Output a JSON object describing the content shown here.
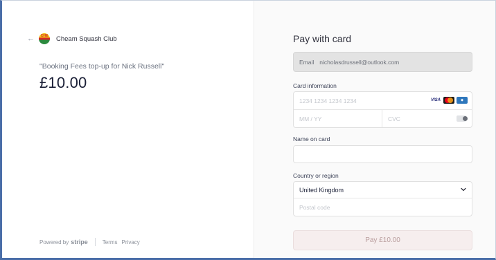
{
  "merchant": {
    "name": "Cheam Squash Club",
    "back_icon": "arrow-left-icon",
    "logo_icon": "club-logo-icon",
    "logo_text": "CHEAM"
  },
  "product": {
    "description": "\"Booking Fees top-up for Nick Russell\"",
    "price": "£10.00"
  },
  "footer": {
    "powered_by": "Powered by",
    "brand": "stripe",
    "terms": "Terms",
    "privacy": "Privacy"
  },
  "form": {
    "title": "Pay with card",
    "email_label": "Email",
    "email_value": "nicholasdrussell@outlook.com",
    "card_info_label": "Card information",
    "card_number_placeholder": "1234 1234 1234 1234",
    "expiry_placeholder": "MM / YY",
    "cvc_placeholder": "CVC",
    "card_brands": [
      "VISA",
      "mastercard",
      "amex"
    ],
    "name_label": "Name on card",
    "name_value": "",
    "country_label": "Country or region",
    "country_value": "United Kingdom",
    "postal_placeholder": "Postal code",
    "pay_button": "Pay £10.00"
  },
  "colors": {
    "pay_button_bg": "#f6eeee",
    "pay_button_text": "#b89c9c",
    "email_bg": "#e3e3e3"
  }
}
